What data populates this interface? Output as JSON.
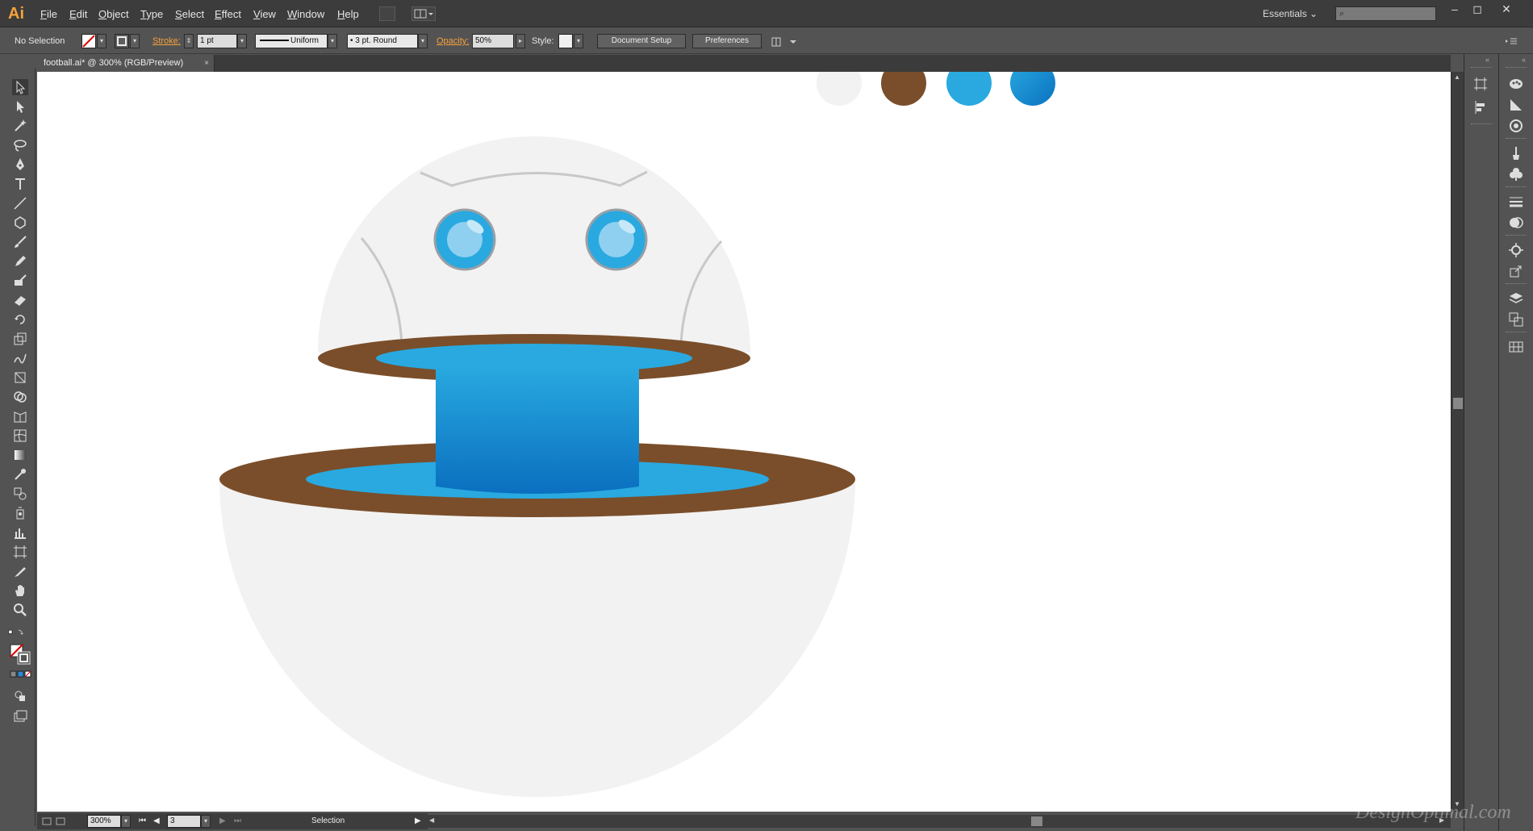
{
  "app": {
    "logo": "Ai"
  },
  "menu": [
    "File",
    "Edit",
    "Object",
    "Type",
    "Select",
    "Effect",
    "View",
    "Window",
    "Help"
  ],
  "workspace": {
    "label": "Essentials",
    "dropdown": "⌄"
  },
  "search": {
    "placeholder": "",
    "icon": "⌕"
  },
  "window_controls": {
    "minimize": "–",
    "maximize": "◻",
    "close": "✕"
  },
  "control_bar": {
    "selection": "No Selection",
    "stroke_label": "Stroke:",
    "stroke_weight": "1 pt",
    "profile": "Uniform",
    "brush": "3 pt. Round",
    "opacity_label": "Opacity:",
    "opacity_value": "50%",
    "style_label": "Style:",
    "document_setup": "Document Setup",
    "preferences": "Preferences"
  },
  "document": {
    "tab_title": "football.ai* @ 300% (RGB/Preview)",
    "close": "×"
  },
  "status_bar": {
    "zoom": "300%",
    "artboard": "3",
    "tool": "Selection"
  },
  "watermark": "DesignOptimal.com",
  "colors": {
    "light_gray": "#f2f2f2",
    "brown": "#7a4e2a",
    "blue": "#29a9e0",
    "blue_dark": "#0a72c0",
    "accent": "#f7a23c"
  },
  "swatches": [
    "#f2f2f2",
    "#7a4e2a",
    "#29a9e0",
    "#1e8fd8"
  ]
}
